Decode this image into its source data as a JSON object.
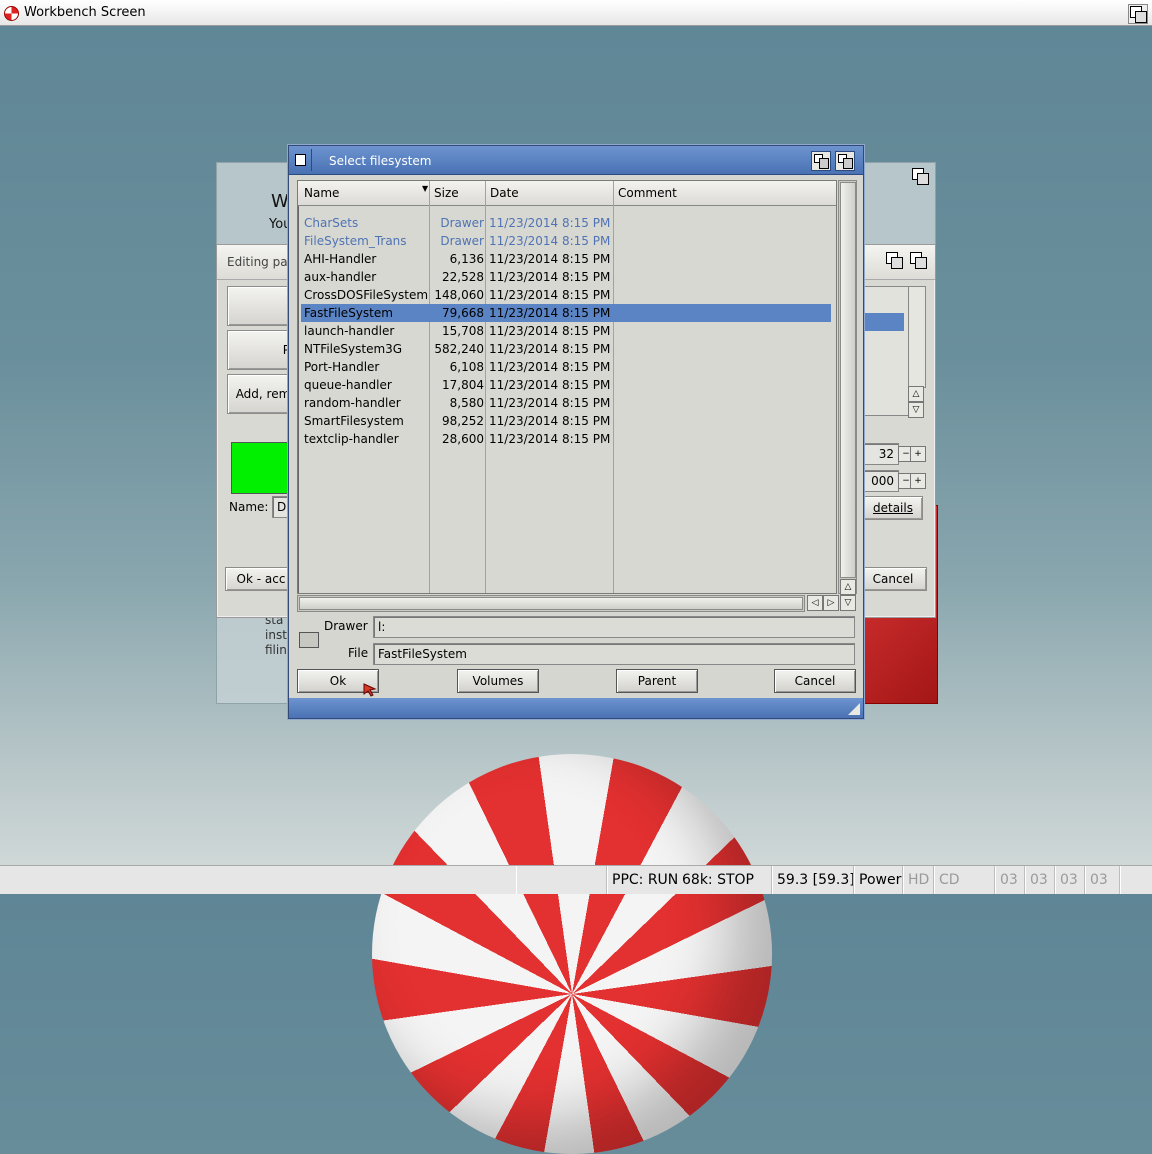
{
  "screen": {
    "title": "Workbench Screen"
  },
  "background": {
    "heading_partial": "W",
    "sub_partial": "You",
    "lines_partial": [
      "sta",
      "inst",
      "filin"
    ]
  },
  "edit_window": {
    "title_partial": "Editing pa",
    "left_buttons": [
      "",
      "P",
      "Add, rem"
    ],
    "name_label": "Name:",
    "name_value_partial": "D",
    "stepper_value_1": "32",
    "stepper_value_2": "000",
    "details_button": "details",
    "ok_button_partial": "Ok - acc",
    "cancel_button": "Cancel"
  },
  "requester": {
    "title": "Select filesystem",
    "columns": {
      "name": "Name",
      "size": "Size",
      "date": "Date",
      "comment": "Comment"
    },
    "rows": [
      {
        "name": "CharSets",
        "size": "Drawer",
        "date": "11/23/2014 8:15 PM",
        "dir": true
      },
      {
        "name": "FileSystem_Trans",
        "size": "Drawer",
        "date": "11/23/2014 8:15 PM",
        "dir": true
      },
      {
        "name": "AHI-Handler",
        "size": "6,136",
        "date": "11/23/2014 8:15 PM"
      },
      {
        "name": "aux-handler",
        "size": "22,528",
        "date": "11/23/2014 8:15 PM"
      },
      {
        "name": "CrossDOSFileSystem",
        "size": "148,060",
        "date": "11/23/2014 8:15 PM"
      },
      {
        "name": "FastFileSystem",
        "size": "79,668",
        "date": "11/23/2014 8:15 PM",
        "selected": true
      },
      {
        "name": "launch-handler",
        "size": "15,708",
        "date": "11/23/2014 8:15 PM"
      },
      {
        "name": "NTFileSystem3G",
        "size": "582,240",
        "date": "11/23/2014 8:15 PM"
      },
      {
        "name": "Port-Handler",
        "size": "6,108",
        "date": "11/23/2014 8:15 PM"
      },
      {
        "name": "queue-handler",
        "size": "17,804",
        "date": "11/23/2014 8:15 PM"
      },
      {
        "name": "random-handler",
        "size": "8,580",
        "date": "11/23/2014 8:15 PM"
      },
      {
        "name": "SmartFilesystem",
        "size": "98,252",
        "date": "11/23/2014 8:15 PM"
      },
      {
        "name": "textclip-handler",
        "size": "28,600",
        "date": "11/23/2014 8:15 PM"
      }
    ],
    "drawer_label": "Drawer",
    "drawer_value": "l:",
    "file_label": "File",
    "file_value": "FastFileSystem",
    "buttons": {
      "ok": "Ok",
      "volumes": "Volumes",
      "parent": "Parent",
      "cancel": "Cancel"
    }
  },
  "statusbar": {
    "ppc": "PPC: RUN",
    "m68k": "68k: STOP",
    "fps": "59.3 [59.3]",
    "power": "Power",
    "hd": "HD",
    "cd": "CD",
    "drives": [
      "03",
      "03",
      "03",
      "03"
    ]
  },
  "colors": {
    "selection": "#5b84c4",
    "titlebar": "#4a72b4",
    "drawer_text": "#4f73b3",
    "led_green": "#00f000"
  }
}
